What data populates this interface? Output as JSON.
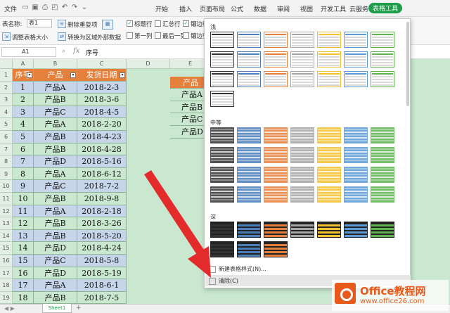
{
  "titlebar": {
    "file_menu": "文件",
    "tabs": [
      "开始",
      "插入",
      "页面布局",
      "公式",
      "数据",
      "审阅",
      "视图",
      "开发工具",
      "云服务",
      "表格工具"
    ],
    "active_tab": "表格工具"
  },
  "ribbon": {
    "table_name_label": "表名称:",
    "table_name_value": "表1",
    "resize_table": "调整表格大小",
    "remove_duplicates": "删除重复项",
    "convert_to_range": "转换为区域",
    "external_data": "外部数据",
    "header_row": "标题行",
    "total_row": "汇总行",
    "banded_rows": "镶边行",
    "first_column": "第一列",
    "last_column": "最后一列",
    "banded_columns": "镶边列"
  },
  "formula_bar": {
    "cell_ref": "A1",
    "fx": "fx",
    "content": "序号"
  },
  "sheet": {
    "columns": [
      "A",
      "B",
      "C",
      "D",
      "E"
    ],
    "row_numbers": [
      "1",
      "2",
      "3",
      "4",
      "5",
      "6",
      "7",
      "8",
      "9",
      "10",
      "11",
      "12",
      "13",
      "14",
      "15",
      "16",
      "17",
      "18",
      "19"
    ],
    "headers": [
      "序号",
      "产品",
      "发货日期"
    ],
    "rows": [
      [
        "1",
        "产品A",
        "2018-2-3"
      ],
      [
        "2",
        "产品B",
        "2018-3-6"
      ],
      [
        "3",
        "产品C",
        "2018-4-5"
      ],
      [
        "4",
        "产品A",
        "2018-2-20"
      ],
      [
        "5",
        "产品B",
        "2018-4-23"
      ],
      [
        "6",
        "产品B",
        "2018-4-28"
      ],
      [
        "7",
        "产品D",
        "2018-5-16"
      ],
      [
        "8",
        "产品A",
        "2018-6-12"
      ],
      [
        "9",
        "产品C",
        "2018-7-2"
      ],
      [
        "10",
        "产品B",
        "2018-9-8"
      ],
      [
        "11",
        "产品A",
        "2018-2-18"
      ],
      [
        "12",
        "产品B",
        "2018-3-26"
      ],
      [
        "13",
        "产品B",
        "2018-5-20"
      ],
      [
        "14",
        "产品D",
        "2018-4-24"
      ],
      [
        "15",
        "产品C",
        "2018-5-8"
      ],
      [
        "16",
        "产品D",
        "2018-5-19"
      ],
      [
        "17",
        "产品A",
        "2018-6-1"
      ],
      [
        "18",
        "产品B",
        "2018-7-5"
      ]
    ],
    "side_header": "产品",
    "side_values": [
      "产品A",
      "产品B",
      "产品C",
      "产品D"
    ],
    "sheet_tab": "Sheet1",
    "add_sheet": "+"
  },
  "gallery": {
    "section_light": "浅",
    "section_medium": "中等",
    "section_dark": "深",
    "new_style": "新建表格样式(N)...",
    "clear": "清除(C)",
    "palette": [
      "#333333",
      "#4a7ebb",
      "#e57f3c",
      "#a5a5a5",
      "#f2c12e",
      "#5b9bd5",
      "#5fb34f"
    ]
  },
  "watermark": {
    "brand": "Office教程网",
    "url": "www.office26.com"
  }
}
